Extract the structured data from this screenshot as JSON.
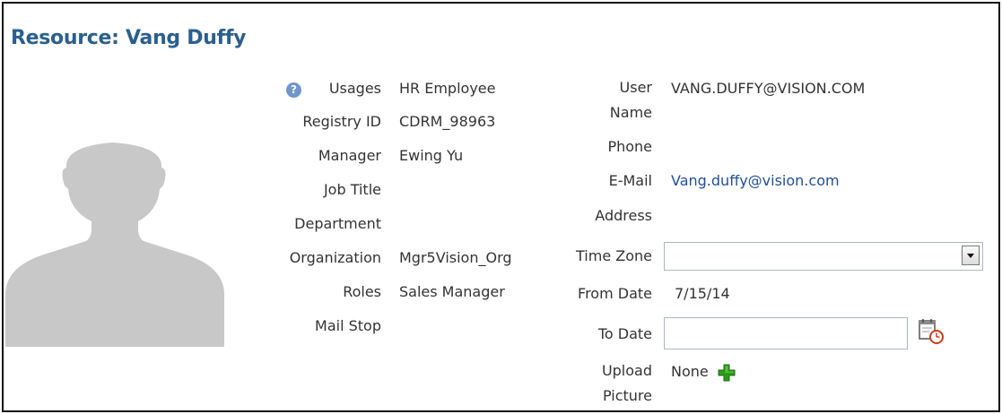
{
  "title": "Resource: Vang Duffy",
  "left_fields": [
    {
      "label": "Usages",
      "value": "HR Employee"
    },
    {
      "label": "Registry ID",
      "value": "CDRM_98963"
    },
    {
      "label": "Manager",
      "value": "Ewing Yu"
    },
    {
      "label": "Job Title",
      "value": ""
    },
    {
      "label": "Department",
      "value": ""
    },
    {
      "label": "Organization",
      "value": "Mgr5Vision_Org"
    },
    {
      "label": "Roles",
      "value": "Sales Manager"
    },
    {
      "label": "Mail Stop",
      "value": ""
    }
  ],
  "right_fields": {
    "user_name": {
      "label": "User Name",
      "value": "VANG.DUFFY@VISION.COM"
    },
    "phone": {
      "label": "Phone",
      "value": ""
    },
    "email": {
      "label": "E-Mail",
      "value": "Vang.duffy@vision.com"
    },
    "address": {
      "label": "Address",
      "value": ""
    },
    "time_zone": {
      "label": "Time Zone",
      "value": ""
    },
    "from_date": {
      "label": "From Date",
      "value": "7/15/14"
    },
    "to_date": {
      "label": "To Date",
      "value": ""
    },
    "upload_picture": {
      "label": "Upload Picture",
      "value": "None"
    }
  },
  "icons": {
    "help": "help-icon",
    "calendar": "calendar-clock-icon",
    "add": "add-plus-icon",
    "dropdown": "chevron-down-icon"
  },
  "colors": {
    "title": "#2a5f8e",
    "link": "#1f4e9a",
    "plus": "#2e9b1f",
    "avatar": "#c8c8c8"
  },
  "help_glyph": "?"
}
